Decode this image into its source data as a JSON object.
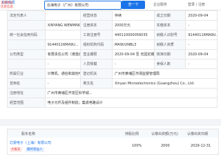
{
  "top": {
    "brand": "企业信息",
    "search_value": "云海电子（广州）有限公司",
    "search_button": "查一下",
    "links": [
      "企业服务",
      "登录 / 注册"
    ]
  },
  "side_tags": [
    "注册地址",
    "历史信息",
    "失信被执行"
  ],
  "info": {
    "rows": [
      [
        "法定代表人",
        "",
        "经营状态",
        "存续",
        "成立日期",
        "2020-09-04"
      ],
      [
        "",
        "XINYANG WENMING",
        "注册资本",
        "2000万元",
        "实缴资本",
        "-"
      ],
      [
        "统一社会信用代码",
        "",
        "工商注册号",
        "440110000056035",
        "纳税人识别号",
        "91440116MA9U..."
      ],
      [
        "",
        "91440116MA9U...",
        "组织机构代码",
        "MA9UUNBL3",
        "纳税人资质",
        "-"
      ],
      [
        "公司类型",
        "有限责任公司（港澳台法人独资）",
        "营业期限",
        "2020-09-04 至 无固定期限",
        "核准日期",
        "2020-09-04"
      ],
      [
        "",
        "-",
        "人员规模",
        "-",
        "参保人数",
        "-"
      ],
      [
        "所属行业",
        "计算机、通信和其他电子设备制造业",
        "登记机关",
        "广州市黄埔区市场监督管理局",
        "",
        ""
      ],
      [
        "曾用名",
        "-",
        "英文名",
        "Xinyan Microelectronics (Guangzhou) Co., Ltd.",
        "",
        ""
      ],
      [
        "注册地址",
        "广州市黄埔区开发区科学城...",
        "",
        "",
        "",
        ""
      ],
      [
        "经营范围",
        "电子元件及组件制造；集成电路设计",
        "",
        "",
        "",
        ""
      ]
    ]
  },
  "shareholders": {
    "headers": [
      "股东名称",
      "持股比例",
      "认缴出资额(万元)",
      "认缴出资日期"
    ],
    "rows": [
      {
        "name": "芯晏电子（上海）有限公司",
        "tag": "大股东",
        "tag2": "最终受益人",
        "ratio": "100%",
        "amount": "2000",
        "date": "2029-12-31"
      }
    ]
  }
}
